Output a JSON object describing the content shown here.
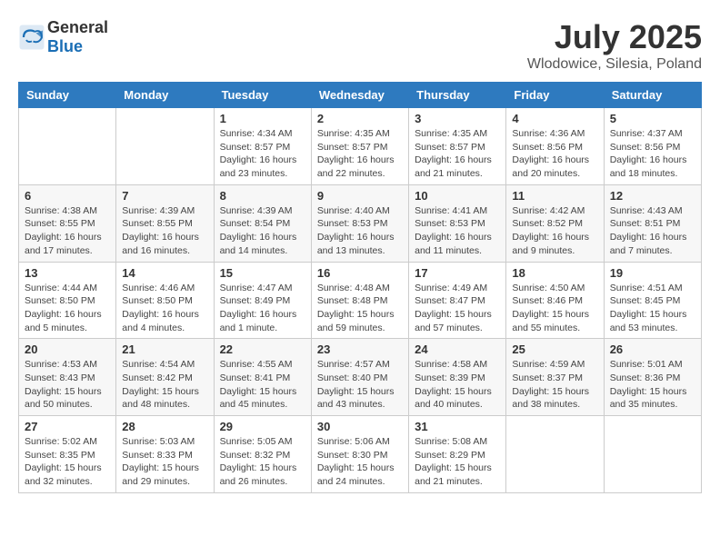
{
  "header": {
    "logo_general": "General",
    "logo_blue": "Blue",
    "title": "July 2025",
    "location": "Wlodowice, Silesia, Poland"
  },
  "calendar": {
    "days_of_week": [
      "Sunday",
      "Monday",
      "Tuesday",
      "Wednesday",
      "Thursday",
      "Friday",
      "Saturday"
    ],
    "weeks": [
      [
        {
          "day": "",
          "info": ""
        },
        {
          "day": "",
          "info": ""
        },
        {
          "day": "1",
          "info": "Sunrise: 4:34 AM\nSunset: 8:57 PM\nDaylight: 16 hours\nand 23 minutes."
        },
        {
          "day": "2",
          "info": "Sunrise: 4:35 AM\nSunset: 8:57 PM\nDaylight: 16 hours\nand 22 minutes."
        },
        {
          "day": "3",
          "info": "Sunrise: 4:35 AM\nSunset: 8:57 PM\nDaylight: 16 hours\nand 21 minutes."
        },
        {
          "day": "4",
          "info": "Sunrise: 4:36 AM\nSunset: 8:56 PM\nDaylight: 16 hours\nand 20 minutes."
        },
        {
          "day": "5",
          "info": "Sunrise: 4:37 AM\nSunset: 8:56 PM\nDaylight: 16 hours\nand 18 minutes."
        }
      ],
      [
        {
          "day": "6",
          "info": "Sunrise: 4:38 AM\nSunset: 8:55 PM\nDaylight: 16 hours\nand 17 minutes."
        },
        {
          "day": "7",
          "info": "Sunrise: 4:39 AM\nSunset: 8:55 PM\nDaylight: 16 hours\nand 16 minutes."
        },
        {
          "day": "8",
          "info": "Sunrise: 4:39 AM\nSunset: 8:54 PM\nDaylight: 16 hours\nand 14 minutes."
        },
        {
          "day": "9",
          "info": "Sunrise: 4:40 AM\nSunset: 8:53 PM\nDaylight: 16 hours\nand 13 minutes."
        },
        {
          "day": "10",
          "info": "Sunrise: 4:41 AM\nSunset: 8:53 PM\nDaylight: 16 hours\nand 11 minutes."
        },
        {
          "day": "11",
          "info": "Sunrise: 4:42 AM\nSunset: 8:52 PM\nDaylight: 16 hours\nand 9 minutes."
        },
        {
          "day": "12",
          "info": "Sunrise: 4:43 AM\nSunset: 8:51 PM\nDaylight: 16 hours\nand 7 minutes."
        }
      ],
      [
        {
          "day": "13",
          "info": "Sunrise: 4:44 AM\nSunset: 8:50 PM\nDaylight: 16 hours\nand 5 minutes."
        },
        {
          "day": "14",
          "info": "Sunrise: 4:46 AM\nSunset: 8:50 PM\nDaylight: 16 hours\nand 4 minutes."
        },
        {
          "day": "15",
          "info": "Sunrise: 4:47 AM\nSunset: 8:49 PM\nDaylight: 16 hours\nand 1 minute."
        },
        {
          "day": "16",
          "info": "Sunrise: 4:48 AM\nSunset: 8:48 PM\nDaylight: 15 hours\nand 59 minutes."
        },
        {
          "day": "17",
          "info": "Sunrise: 4:49 AM\nSunset: 8:47 PM\nDaylight: 15 hours\nand 57 minutes."
        },
        {
          "day": "18",
          "info": "Sunrise: 4:50 AM\nSunset: 8:46 PM\nDaylight: 15 hours\nand 55 minutes."
        },
        {
          "day": "19",
          "info": "Sunrise: 4:51 AM\nSunset: 8:45 PM\nDaylight: 15 hours\nand 53 minutes."
        }
      ],
      [
        {
          "day": "20",
          "info": "Sunrise: 4:53 AM\nSunset: 8:43 PM\nDaylight: 15 hours\nand 50 minutes."
        },
        {
          "day": "21",
          "info": "Sunrise: 4:54 AM\nSunset: 8:42 PM\nDaylight: 15 hours\nand 48 minutes."
        },
        {
          "day": "22",
          "info": "Sunrise: 4:55 AM\nSunset: 8:41 PM\nDaylight: 15 hours\nand 45 minutes."
        },
        {
          "day": "23",
          "info": "Sunrise: 4:57 AM\nSunset: 8:40 PM\nDaylight: 15 hours\nand 43 minutes."
        },
        {
          "day": "24",
          "info": "Sunrise: 4:58 AM\nSunset: 8:39 PM\nDaylight: 15 hours\nand 40 minutes."
        },
        {
          "day": "25",
          "info": "Sunrise: 4:59 AM\nSunset: 8:37 PM\nDaylight: 15 hours\nand 38 minutes."
        },
        {
          "day": "26",
          "info": "Sunrise: 5:01 AM\nSunset: 8:36 PM\nDaylight: 15 hours\nand 35 minutes."
        }
      ],
      [
        {
          "day": "27",
          "info": "Sunrise: 5:02 AM\nSunset: 8:35 PM\nDaylight: 15 hours\nand 32 minutes."
        },
        {
          "day": "28",
          "info": "Sunrise: 5:03 AM\nSunset: 8:33 PM\nDaylight: 15 hours\nand 29 minutes."
        },
        {
          "day": "29",
          "info": "Sunrise: 5:05 AM\nSunset: 8:32 PM\nDaylight: 15 hours\nand 26 minutes."
        },
        {
          "day": "30",
          "info": "Sunrise: 5:06 AM\nSunset: 8:30 PM\nDaylight: 15 hours\nand 24 minutes."
        },
        {
          "day": "31",
          "info": "Sunrise: 5:08 AM\nSunset: 8:29 PM\nDaylight: 15 hours\nand 21 minutes."
        },
        {
          "day": "",
          "info": ""
        },
        {
          "day": "",
          "info": ""
        }
      ]
    ]
  }
}
